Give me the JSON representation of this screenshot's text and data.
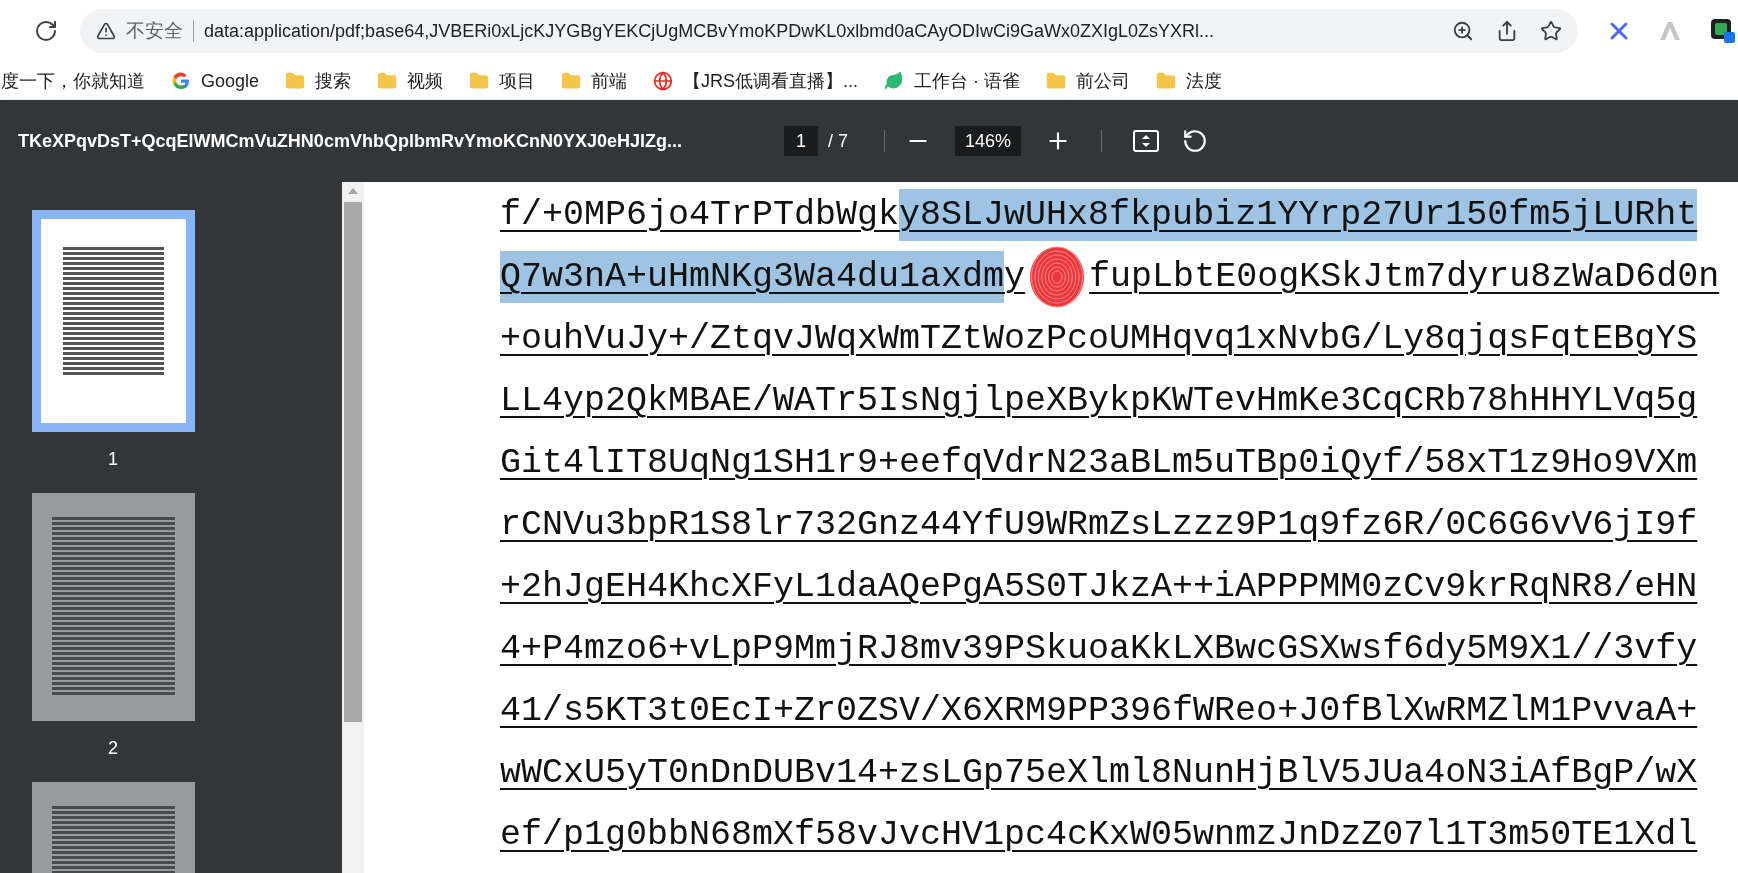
{
  "browser": {
    "security_label": "不安全",
    "address": "data:application/pdf;base64,JVBERi0xLjcKJYGBgYEKCjUgMCBvYmoKPDwKL0xlbmd0aCAyODIwCi9GaWx0ZXIgL0ZsYXRl...",
    "bookmarks": [
      {
        "kind": "plain",
        "label": "度一下，你就知道"
      },
      {
        "kind": "google",
        "label": "Google"
      },
      {
        "kind": "folder",
        "label": "搜索"
      },
      {
        "kind": "folder",
        "label": "视频"
      },
      {
        "kind": "folder",
        "label": "项目"
      },
      {
        "kind": "folder",
        "label": "前端"
      },
      {
        "kind": "globe",
        "label": "【JRS低调看直播】..."
      },
      {
        "kind": "leaf",
        "label": "工作台 · 语雀"
      },
      {
        "kind": "folder",
        "label": "前公司"
      },
      {
        "kind": "folder",
        "label": "法度"
      }
    ]
  },
  "pdf_toolbar": {
    "title": "TKeXPqvDsT+QcqElWMCmVuZHN0cmVhbQplbmRvYmoKCnN0YXJ0eHJlZg...",
    "page": "1",
    "page_total": "/ 7",
    "zoom": "146%"
  },
  "thumbnails": [
    {
      "label": "1",
      "selected": true
    },
    {
      "label": "2",
      "selected": false
    },
    {
      "selected": false
    }
  ],
  "document": {
    "lines": [
      {
        "segments": [
          {
            "kind": "text",
            "text": "f/+0MP6jo4TrPTdbWgk",
            "selected": false
          },
          {
            "kind": "text",
            "text": "y8SLJwUHx8fkpubiz1YYrp27Ur150fm5jLURht",
            "selected": true
          }
        ]
      },
      {
        "segments": [
          {
            "kind": "text",
            "text": "Q7w3nA+uHmNKg3Wa4du1axdm",
            "selected": true
          },
          {
            "kind": "text",
            "text": "y",
            "selected": false
          },
          {
            "kind": "stamp"
          },
          {
            "kind": "text",
            "text": "fupLbtE0ogKSkJtm7dyru8zWaD6d0n",
            "selected": false
          }
        ]
      },
      {
        "segments": [
          {
            "kind": "text",
            "text": "+ouhVuJy+/ZtqvJWqxWmTZtWozPcoUMHqvq1xNvbG/Ly8qjqsFqtEBgYS",
            "selected": false
          }
        ]
      },
      {
        "segments": [
          {
            "kind": "text",
            "text": "LL4yp2QkMBAE/WATr5IsNgjlpeXBykpKWTevHmKe3CqCRb78hHHYLVq5g",
            "selected": false
          }
        ]
      },
      {
        "segments": [
          {
            "kind": "text",
            "text": "Git4lIT8UqNg1SH1r9+eefqVdrN23aBLm5uTBp0iQyf/58xT1z9Ho9VXm",
            "selected": false
          }
        ]
      },
      {
        "segments": [
          {
            "kind": "text",
            "text": "rCNVu3bpR1S8lr732Gnz44YfU9WRmZsLzzz9P1q9fz6R/0C6G6vV6jI9f",
            "selected": false
          }
        ]
      },
      {
        "segments": [
          {
            "kind": "text",
            "text": "+2hJgEH4KhcXFyL1daAQePgA5S0TJkzA++iAPPPMM0zCv9krRqNR8/eHN",
            "selected": false
          }
        ]
      },
      {
        "segments": [
          {
            "kind": "text",
            "text": "4+P4mzo6+vLpP9MmjRJ8mv39PSkuoaKkLXBwcGSXwsf6dy5M9X1//3vfy",
            "selected": false
          }
        ]
      },
      {
        "segments": [
          {
            "kind": "text",
            "text": "41/s5KT3t0EcI+Zr0ZSV/X6XRM9PP396fWReo+J0fBlXwRMZlM1PvvaA+",
            "selected": false
          }
        ]
      },
      {
        "segments": [
          {
            "kind": "text",
            "text": "wWCxU5yT0nDnDUBv14+zsLGp75eXlml8NunHjBlV5JUa4oN3iAfBgP/wX",
            "selected": false
          }
        ]
      },
      {
        "segments": [
          {
            "kind": "text",
            "text": "ef/p1g0bbN68mXf58vJvcHV1pc4cKxW05wnmzJnDzZ07l1T3m50TE1Xdl",
            "selected": false
          }
        ]
      }
    ]
  }
}
